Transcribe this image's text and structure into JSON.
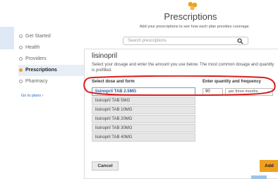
{
  "header": {
    "title": "Prescriptions",
    "subtitle": "Add your prescriptions to see how each plan provides coverage."
  },
  "search": {
    "placeholder": "Search prescriptions"
  },
  "sidebar": {
    "items": [
      {
        "label": "Get Started",
        "active": false
      },
      {
        "label": "Health",
        "active": false
      },
      {
        "label": "Providers",
        "active": false
      },
      {
        "label": "Prescriptions",
        "active": true
      },
      {
        "label": "Pharmacy",
        "active": false
      }
    ],
    "go_to_plans": "Go to plans ›"
  },
  "drug": {
    "name": "lisinopril",
    "instructions": "Select your dosage and enter the amount you use below. The most common dosage and quantity is prefilled.",
    "dose_label": "Select dose and form",
    "quantity_label": "Enter quantity and frequency",
    "doses": [
      {
        "label": "lisinopril TAB 2.5MG",
        "selected": true
      },
      {
        "label": "lisinopril TAB 5MG",
        "selected": false
      },
      {
        "label": "lisinopril TAB 10MG",
        "selected": false
      },
      {
        "label": "lisinopril TAB 20MG",
        "selected": false
      },
      {
        "label": "lisinopril TAB 30MG",
        "selected": false
      },
      {
        "label": "lisinopril TAB 40MG",
        "selected": false
      }
    ],
    "quantity": "90",
    "frequency": "per three months"
  },
  "actions": {
    "cancel_label": "Cancel",
    "add_label": "Add"
  },
  "colors": {
    "accent": "#f0a020",
    "highlight_ring": "#d81e1e",
    "link": "#2a6ab8"
  }
}
